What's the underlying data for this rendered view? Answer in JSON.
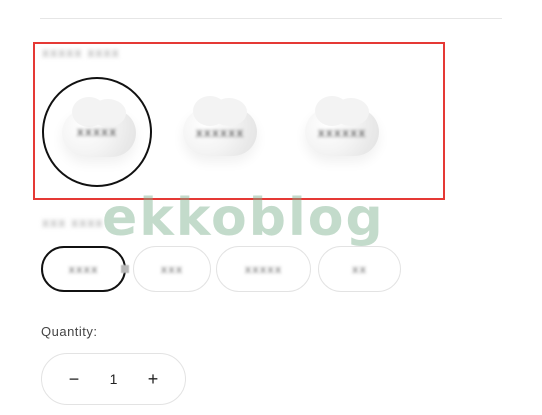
{
  "section_top": {
    "divider": true
  },
  "color_option": {
    "label": "xxxxx xxxx",
    "highlight_color": "#e53935",
    "options": [
      {
        "label": "xxxxx",
        "selected": true
      },
      {
        "label": "xxxxxx",
        "selected": false
      },
      {
        "label": "xxxxxx",
        "selected": false
      }
    ]
  },
  "size_option": {
    "label": "xxx xxxx",
    "options": [
      {
        "label": "xxxx",
        "selected": true
      },
      {
        "label": "xxx",
        "selected": false
      },
      {
        "label": "xxxxx",
        "selected": false
      },
      {
        "label": "xx",
        "selected": false
      }
    ]
  },
  "quantity": {
    "label": "Quantity:",
    "value": "1",
    "minus_symbol": "−",
    "plus_symbol": "+"
  },
  "watermark": {
    "text": "ekkoblog"
  },
  "colors": {
    "accent_red": "#e53935",
    "selected_border": "#111111",
    "watermark_green": "#7bb08d"
  }
}
